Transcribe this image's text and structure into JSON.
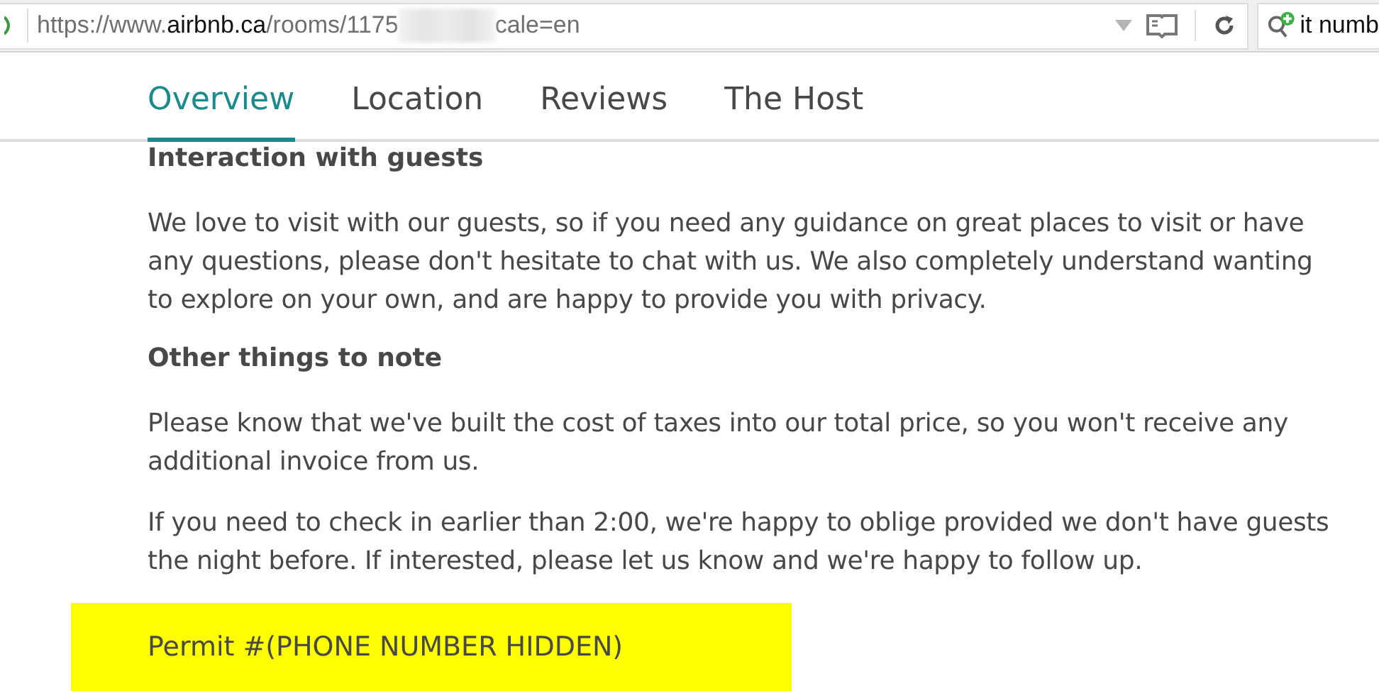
{
  "browser": {
    "url_prefix": "https://www.",
    "url_domain": "airbnb.ca",
    "url_path": "/rooms/1175",
    "url_suffix": "cale=en",
    "search_value": "it numb"
  },
  "tabs": [
    {
      "label": "Overview",
      "selected": true
    },
    {
      "label": "Location",
      "selected": false
    },
    {
      "label": "Reviews",
      "selected": false
    },
    {
      "label": "The Host",
      "selected": false
    }
  ],
  "sections": [
    {
      "kind": "heading",
      "text": "Interaction with guests"
    },
    {
      "kind": "paragraph",
      "text": "We love to visit with our guests, so if you need any guidance on great places to visit or have any questions, please don't hesitate to chat with us. We also completely understand wanting to explore on your own, and are happy to provide you with privacy."
    },
    {
      "kind": "heading",
      "text": "Other things to note"
    },
    {
      "kind": "paragraph",
      "text": "Please know that we've built the cost of taxes into our total price, so you won't receive any additional invoice from us."
    },
    {
      "kind": "paragraph",
      "text": "If you need to check in earlier than 2:00, we're happy to oblige provided we don't have guests the night before. If interested, please let us know and we're happy to follow up."
    },
    {
      "kind": "highlight",
      "text": "Permit #(PHONE NUMBER HIDDEN)"
    }
  ]
}
